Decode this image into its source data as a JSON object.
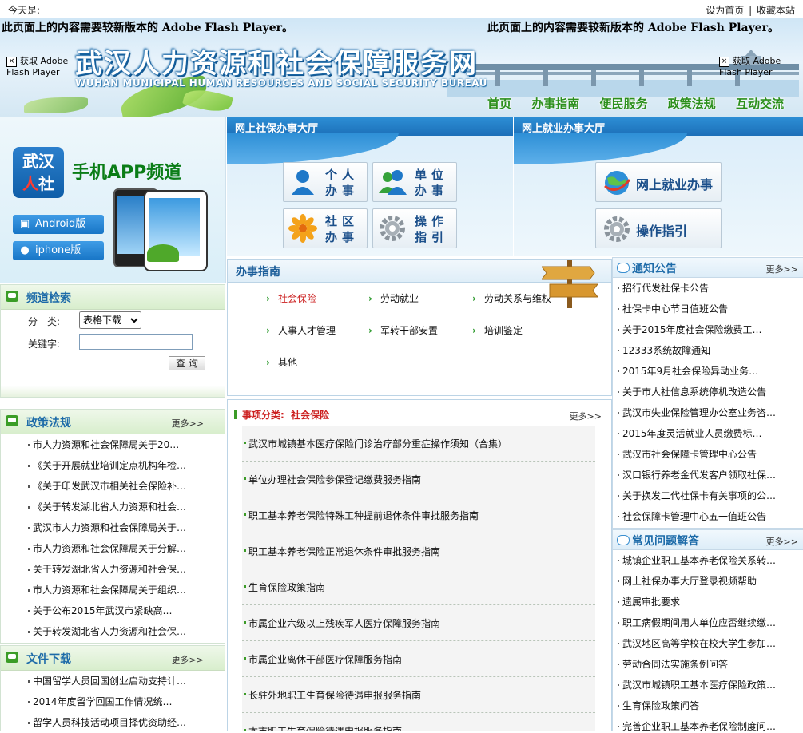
{
  "topbar": {
    "today_label": "今天是:",
    "set_home": "设为首页",
    "sep": "|",
    "bookmark": "收藏本站"
  },
  "banner": {
    "flash_msg_left": "此页面上的内容需要较新版本的 Adobe Flash Player。",
    "flash_msg_right": "此页面上的内容需要较新版本的 Adobe Flash Player。",
    "get_flash": "获取 Adobe Flash Player",
    "title_cn": "武汉人力资源和社会保障服务网",
    "title_en": "WUHAN MUNICIPAL HUMAN RESOURCES AND SOCIAL SECURITY BUREAU"
  },
  "nav": [
    "首页",
    "办事指南",
    "便民服务",
    "政策法规",
    "互动交流"
  ],
  "app": {
    "logo_line1": "武汉",
    "logo_line2_a": "人",
    "logo_line2_b": "社",
    "title": "手机APP频道",
    "android": "Android版",
    "iphone": "iphone版"
  },
  "hall_social": {
    "title": "网上社保办事大厅",
    "buttons": [
      {
        "label": "个人办事",
        "icon": "person-icon"
      },
      {
        "label": "单位办事",
        "icon": "group-icon"
      },
      {
        "label": "社区办事",
        "icon": "flower-icon"
      },
      {
        "label": "操作指引",
        "icon": "gear-icon"
      }
    ]
  },
  "hall_employ": {
    "title": "网上就业办事大厅",
    "buttons": [
      {
        "label": "网上就业办事",
        "icon": "globe-icon"
      },
      {
        "label": "操作指引",
        "icon": "gear-icon"
      }
    ]
  },
  "search": {
    "title": "频道检索",
    "category_label": "分　类:",
    "category_value": "表格下载",
    "keyword_label": "关键字:",
    "keyword_value": "",
    "submit": "查 询"
  },
  "policy": {
    "title": "政策法规",
    "more": "更多>>",
    "items": [
      "市人力资源和社会保障局关于20…",
      "《关于开展就业培训定点机构年检…",
      "《关于印发武汉市相关社会保险补…",
      "《关于转发湖北省人力资源和社会…",
      "武汉市人力资源和社会保障局关于…",
      "市人力资源和社会保障局关于分解…",
      "关于转发湖北省人力资源和社会保…",
      "市人力资源和社会保障局关于组织…",
      "关于公布2015年武汉市紧缺高…",
      "关于转发湖北省人力资源和社会保…"
    ]
  },
  "downloads": {
    "title": "文件下载",
    "more": "更多>>",
    "items": [
      "中国留学人员回国创业启动支持计…",
      "2014年度留学回国工作情况统…",
      "留学人员科技活动项目择优资助经…"
    ]
  },
  "guide": {
    "title": "办事指南",
    "items": [
      {
        "label": "社会保险",
        "active": true
      },
      {
        "label": "劳动就业",
        "active": false
      },
      {
        "label": "劳动关系与维权",
        "active": false
      },
      {
        "label": "人事人才管理",
        "active": false
      },
      {
        "label": "军转干部安置",
        "active": false
      },
      {
        "label": "培训鉴定",
        "active": false
      },
      {
        "label": "其他",
        "active": false
      }
    ]
  },
  "list": {
    "category_label": "事项分类:",
    "category_value": "社会保险",
    "more": "更多>>",
    "items": [
      "武汉市城镇基本医疗保险门诊治疗部分重症操作须知（合集）",
      "单位办理社会保险参保登记缴费服务指南",
      "职工基本养老保险特殊工种提前退休条件审批服务指南",
      "职工基本养老保险正常退休条件审批服务指南",
      "生育保险政策指南",
      "市属企业六级以上残疾军人医疗保障服务指南",
      "市属企业离休干部医疗保障服务指南",
      "长驻外地职工生育保险待遇申报服务指南",
      "本市职工生育保险待遇申报服务指南"
    ]
  },
  "notices": {
    "title": "通知公告",
    "more": "更多>>",
    "items": [
      "招行代发社保卡公告",
      "社保卡中心节日值班公告",
      "关于2015年度社会保险缴费工…",
      "12333系统故障通知",
      "2015年9月社会保险异动业务…",
      "关于市人社信息系统停机改造公告",
      "武汉市失业保险管理办公室业务咨…",
      "2015年度灵活就业人员缴费标…",
      "武汉市社会保障卡管理中心公告",
      "汉口银行养老金代发客户领取社保…",
      "关于换发二代社保卡有关事项的公…",
      "社会保障卡管理中心五一值班公告"
    ]
  },
  "faq": {
    "title": "常见问题解答",
    "more": "更多>>",
    "items": [
      "城镇企业职工基本养老保险关系转…",
      "网上社保办事大厅登录视频帮助",
      "遗属审批要求",
      "职工病假期间用人单位应否继续缴…",
      "武汉地区高等学校在校大学生参加…",
      "劳动合同法实施条例问答",
      "武汉市城镇职工基本医疗保险政策…",
      "生育保险政策问答",
      "完善企业职工基本养老保险制度问…"
    ]
  },
  "colors": {
    "brand_blue": "#1c6aa8",
    "brand_green": "#2b8f1c",
    "accent_red": "#cc1f1f"
  }
}
